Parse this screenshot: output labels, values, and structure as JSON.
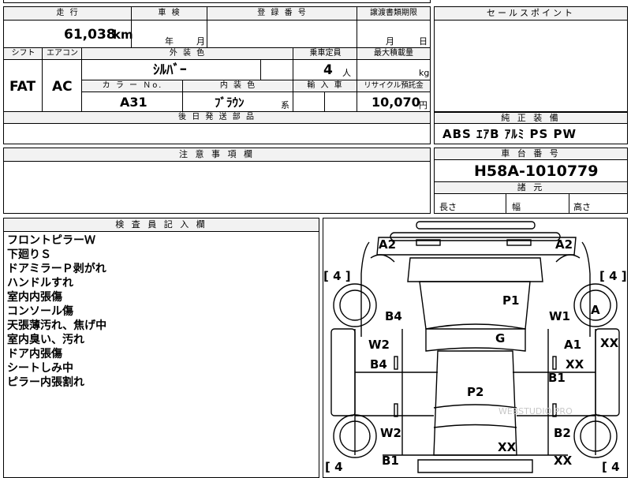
{
  "main": {
    "mileage_label": "走 行",
    "mileage_value": "61,038",
    "mileage_unit": "km",
    "inspection_label": "車 検",
    "inspection_year": "年",
    "inspection_month": "月",
    "registration_label": "登 録 番 号",
    "transfer_label": "譲渡書類期限",
    "transfer_month": "月",
    "transfer_day": "日",
    "shift_label": "シフト",
    "ac_label": "エアコン",
    "ext_color_label": "外 装 色",
    "ext_color_value": "ｼﾙﾊﾞｰ",
    "capacity_label": "乗車定員",
    "capacity_value": "4",
    "capacity_unit": "人",
    "max_load_label": "最大積載量",
    "max_load_unit": "kg",
    "shift_value": "FAT",
    "ac_value": "AC",
    "color_no_label": "カ ラ ー Ｎo.",
    "color_no_value": "A31",
    "int_color_label": "内 装 色",
    "int_color_value": "ﾌﾞﾗｳﾝ",
    "int_color_suffix": "系",
    "import_label": "輸 入 車",
    "recycle_label": "リサイクル預託金",
    "recycle_value": "10,070",
    "recycle_unit": "円",
    "later_parts_label": "後 日 発 送 部 品"
  },
  "sales": {
    "title": "セールスポイント"
  },
  "equipment": {
    "title": "純 正 装 備",
    "value": "ABS ｴｱB ｱﾙﾐ PS PW"
  },
  "notes": {
    "title": "注 意 事 項 欄"
  },
  "chassis": {
    "title": "車 台 番 号",
    "value": "H58A-1010779",
    "dims_title": "諸 元",
    "length_label": "長さ",
    "width_label": "幅",
    "height_label": "高さ"
  },
  "inspector": {
    "title": "検 査 員 記 入 欄",
    "lines": [
      "フロントピラーＷ",
      "下廻りＳ",
      "ドアミラーＰ剥がれ",
      "ハンドルすれ",
      "室内内張傷",
      "コンソール傷",
      "天張薄汚れ、焦げ中",
      "室内臭い、汚れ",
      "ドア内張傷",
      "シートしみ中",
      "ピラー内張割れ"
    ]
  },
  "diagram": {
    "marks": {
      "a2_left": "A2",
      "a2_right": "A2",
      "tire_fl": "[ 4 ]",
      "tire_fr": "[ 4 ]",
      "tire_rl": "[ 4",
      "tire_rr": "[ 4",
      "p1": "P1",
      "b4_top": "B4",
      "w1": "W1",
      "a_wheel": "A",
      "g": "G",
      "w2_top": "W2",
      "a1": "A1",
      "xx_right": "XX",
      "b4_mid": "B4",
      "xx_mid": "XX",
      "b1_right": "B1",
      "p2": "P2",
      "w2_bottom": "W2",
      "b2": "B2",
      "xx_bottom_center": "XX",
      "b1_bottom": "B1",
      "xx_bottom_right": "XX"
    },
    "watermark": "WEBSTUDIO PRO"
  }
}
